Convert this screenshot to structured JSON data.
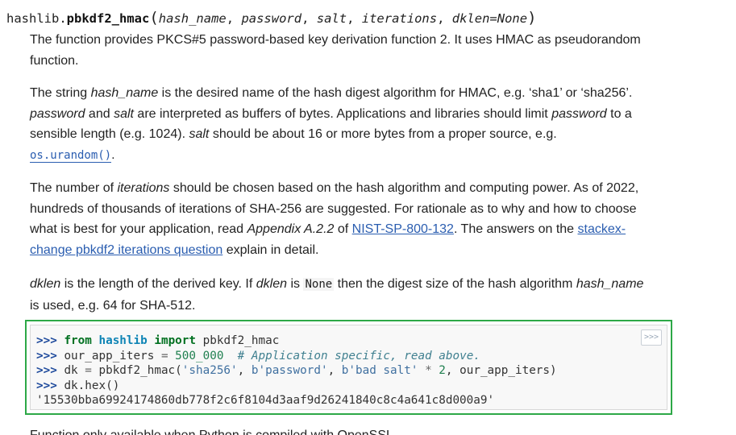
{
  "signature": {
    "module": "hashlib.",
    "function": "pbkdf2_hmac",
    "open_paren": "(",
    "args": [
      "hash_name",
      "password",
      "salt",
      "iterations",
      "dklen=None"
    ],
    "sep": ", ",
    "close_paren": ")"
  },
  "p1": {
    "text": "The function provides PKCS#5 password-based key derivation function 2. It uses HMAC as pseudorandom function."
  },
  "p2": {
    "t1": "The string ",
    "e1": "hash_name",
    "t2": " is the desired name of the hash digest algorithm for HMAC, e.g. ‘sha1’ or ‘sha256’. ",
    "e2": "password",
    "t3": " and ",
    "e3": "salt",
    "t4": " are interpreted as buffers of bytes. Applications and libraries should limit ",
    "e4": "password",
    "t5": " to a sensible length (e.g. 1024). ",
    "e5": "salt",
    "t6": " should be about 16 or more bytes from a proper source, e.g. ",
    "link": "os.urandom()",
    "t7": "."
  },
  "p3": {
    "t1": "The number of ",
    "e1": "iterations",
    "t2": " should be chosen based on the hash algorithm and computing power. As of 2022, hundreds of thousands of iterations of SHA-256 are suggested. For rationale as to why and how to choose what is best for your application, read ",
    "e2": "Appendix A.2.2",
    "t3": " of ",
    "link1": "NIST-SP-800-132",
    "t4": ". The answers on the ",
    "link2": "stackex-change pbkdf2 iterations question",
    "t5": " explain in detail."
  },
  "p4": {
    "e1": "dklen",
    "t1": " is the length of the derived key. If ",
    "e2": "dklen",
    "t2": " is ",
    "code": "None",
    "t3": " then the digest size of the hash algorithm ",
    "e3": "hash_name",
    "t4": " is used, e.g. 64 for SHA-512."
  },
  "code": {
    "prompt": ">>>",
    "l1": {
      "kw1": "from",
      "mod": "hashlib",
      "kw2": "import",
      "name": "pbkdf2_hmac"
    },
    "l2": {
      "name": "our_app_iters",
      "op": "=",
      "num": "500_000",
      "comment": "# Application specific, read above."
    },
    "l3": {
      "a": "dk",
      "op1": "=",
      "fn": "pbkdf2_hmac(",
      "s1": "'sha256'",
      "s2": "b'password'",
      "s3": "b'bad salt'",
      "op2": "*",
      "n": "2",
      "rest": ", our_app_iters)"
    },
    "l4": {
      "text": "dk.hex()"
    },
    "output": "'15530bba69924174860db778f2c6f8104d3aaf9d26241840c8c4a641c8d000a9'",
    "copy_label": ">>>"
  },
  "next": {
    "text": "Function only available when Python is compiled with OpenSSL."
  }
}
